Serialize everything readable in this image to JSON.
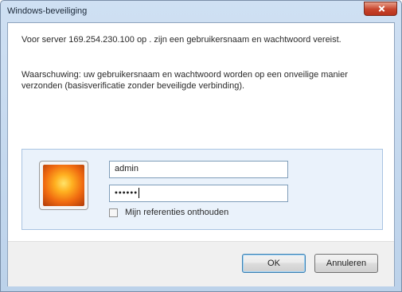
{
  "window": {
    "title": "Windows-beveiliging"
  },
  "message": {
    "server_line": "Voor server 169.254.230.100 op . zijn een gebruikersnaam en wachtwoord vereist.",
    "warning": "Waarschuwing: uw gebruikersnaam en wachtwoord worden op een onveilige manier verzonden (basisverificatie zonder beveiligde verbinding)."
  },
  "credentials": {
    "username_value": "admin",
    "password_value": "••••••",
    "remember_label": "Mijn referenties onthouden",
    "remember_checked": false
  },
  "buttons": {
    "ok_label": "OK",
    "cancel_label": "Annuleren"
  },
  "colors": {
    "titlebar": "#c6daf0",
    "close_button": "#c7442c",
    "panel": "#eaf2fb",
    "footer": "#f0f0f0"
  },
  "icons": {
    "close": "close-icon",
    "user_tile": "user-tile-icon",
    "checkbox": "checkbox-icon"
  }
}
